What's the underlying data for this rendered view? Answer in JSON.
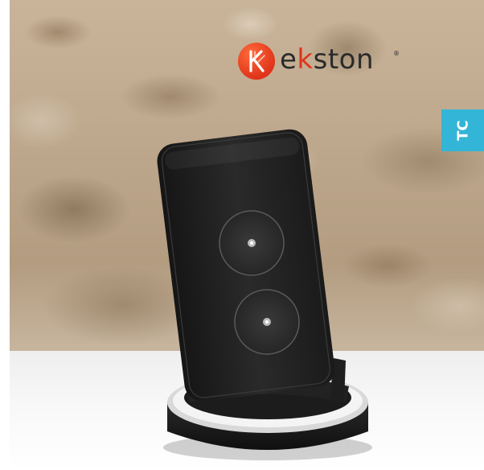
{
  "brand": {
    "name_prefix": "ek",
    "name_accent": "k",
    "name_suffix": "ston",
    "name_start": "e",
    "registered_mark": "®",
    "accent_color": "#e0341a"
  },
  "side_tab": {
    "label": "TC",
    "color": "#33b5d7"
  },
  "product": {
    "icon": "wireless-charger-stand"
  }
}
